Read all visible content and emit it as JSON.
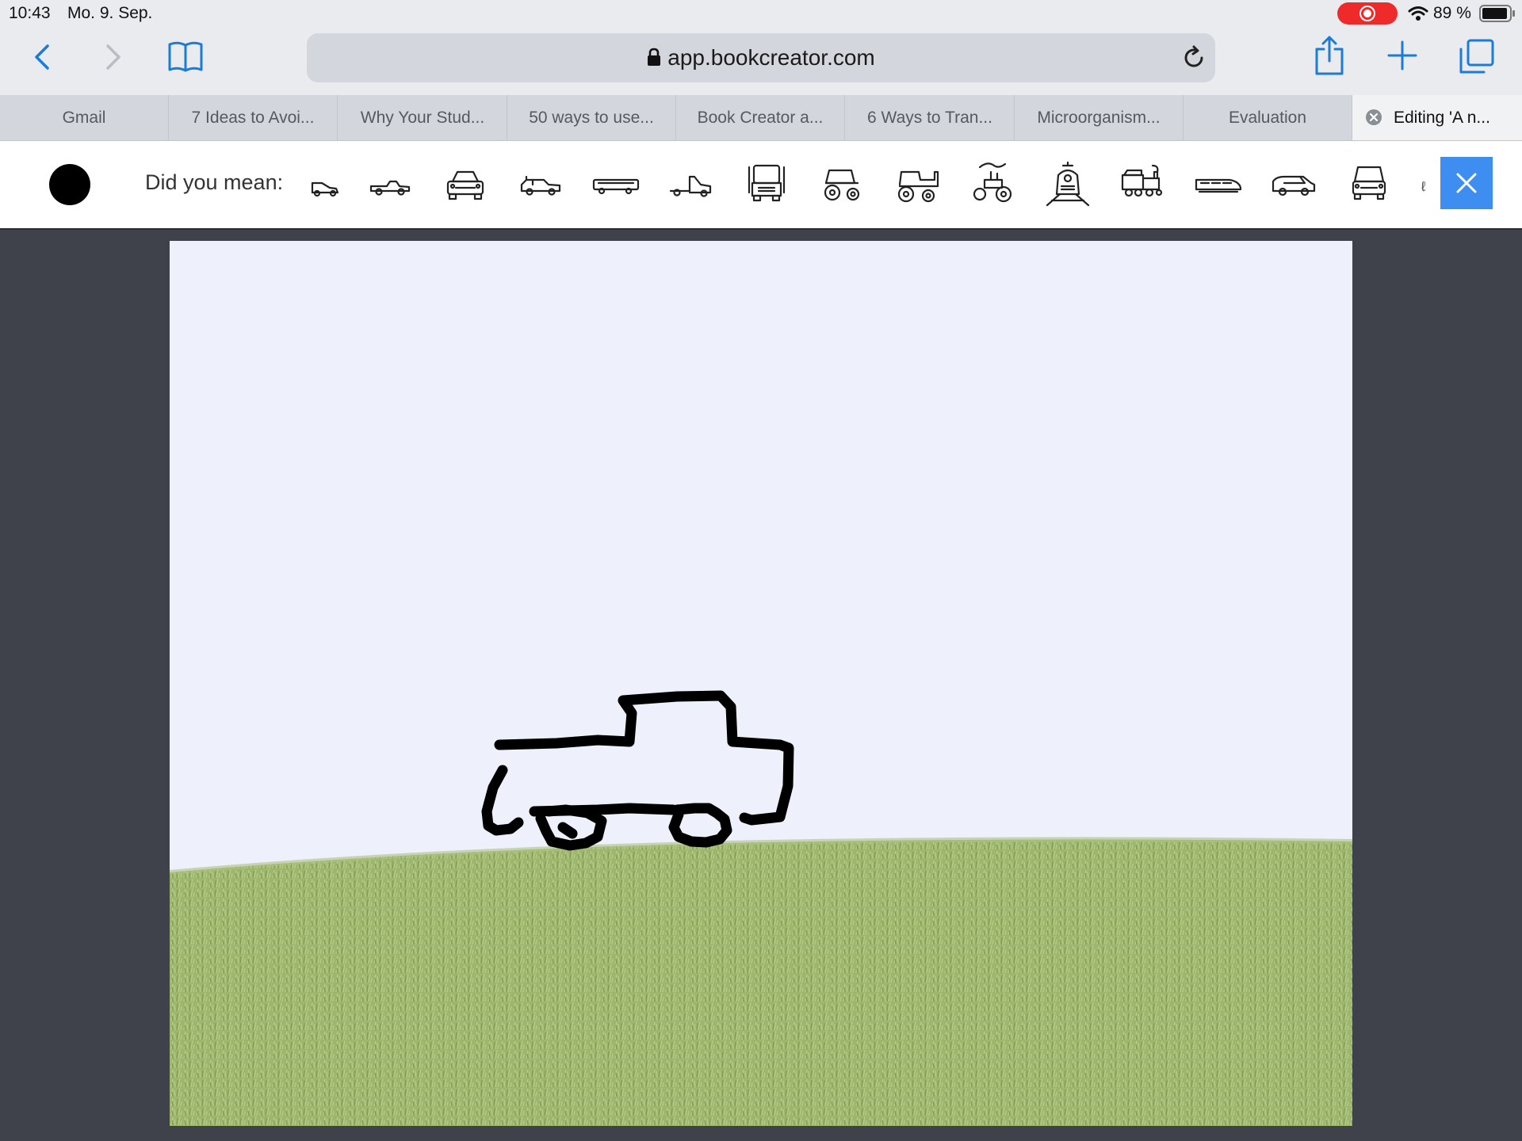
{
  "status_bar": {
    "time": "10:43",
    "date": "Mo. 9. Sep.",
    "battery": "89 %",
    "recording_color": "#ee2a2a"
  },
  "browser": {
    "url": "app.bookcreator.com",
    "accent_color": "#1a7bd8",
    "icons": [
      "back-icon",
      "forward-icon",
      "bookmarks-icon",
      "lock-icon",
      "reload-icon",
      "share-icon",
      "new-tab-icon",
      "tabs-icon"
    ],
    "tabs": [
      {
        "label": "Gmail"
      },
      {
        "label": "7 Ideas to Avoi..."
      },
      {
        "label": "Why Your Stud..."
      },
      {
        "label": "50 ways to use..."
      },
      {
        "label": "Book Creator a..."
      },
      {
        "label": "6 Ways to Tran..."
      },
      {
        "label": "Microorganism..."
      },
      {
        "label": "Evaluation"
      },
      {
        "label": "Editing 'A n...",
        "active": true
      }
    ]
  },
  "suggestions": {
    "label": "Did you mean:",
    "selected_color": "#000000",
    "items": [
      "sports-car-icon",
      "pickup-truck-icon",
      "car-front-icon",
      "suv-icon",
      "bus-side-icon",
      "semi-cab-icon",
      "semi-truck-front-icon",
      "tractor-icon",
      "tractor-side-icon",
      "steam-tractor-icon",
      "train-front-icon",
      "steam-locomotive-icon",
      "high-speed-train-icon",
      "van-icon",
      "van-front-icon"
    ],
    "more": "ℓ",
    "close_color": "#3d8ef0"
  },
  "canvas": {
    "background": "#eef0fb",
    "ground_color": "#9bb36a",
    "drawing": "freehand-truck-sketch"
  }
}
